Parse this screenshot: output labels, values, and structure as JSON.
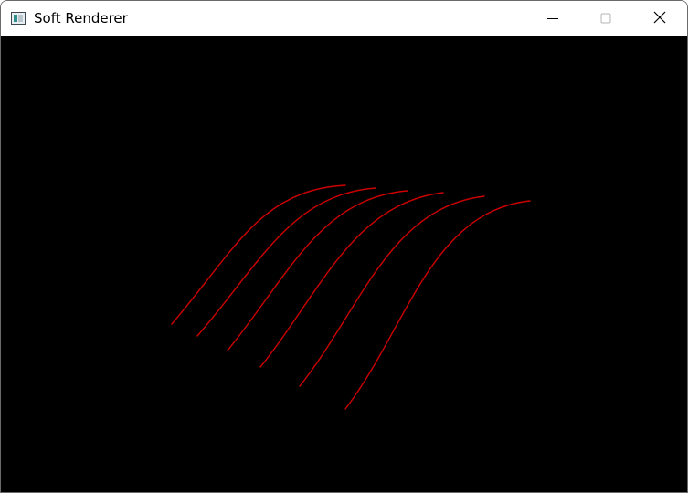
{
  "window": {
    "title": "Soft Renderer",
    "icons": {
      "app": "app-window-icon",
      "minimize": "minimize-icon",
      "maximize": "maximize-icon",
      "close": "close-icon"
    }
  },
  "scene": {
    "background_color": "#000000",
    "curve_color": "#cc0000",
    "curve_count": 6
  }
}
